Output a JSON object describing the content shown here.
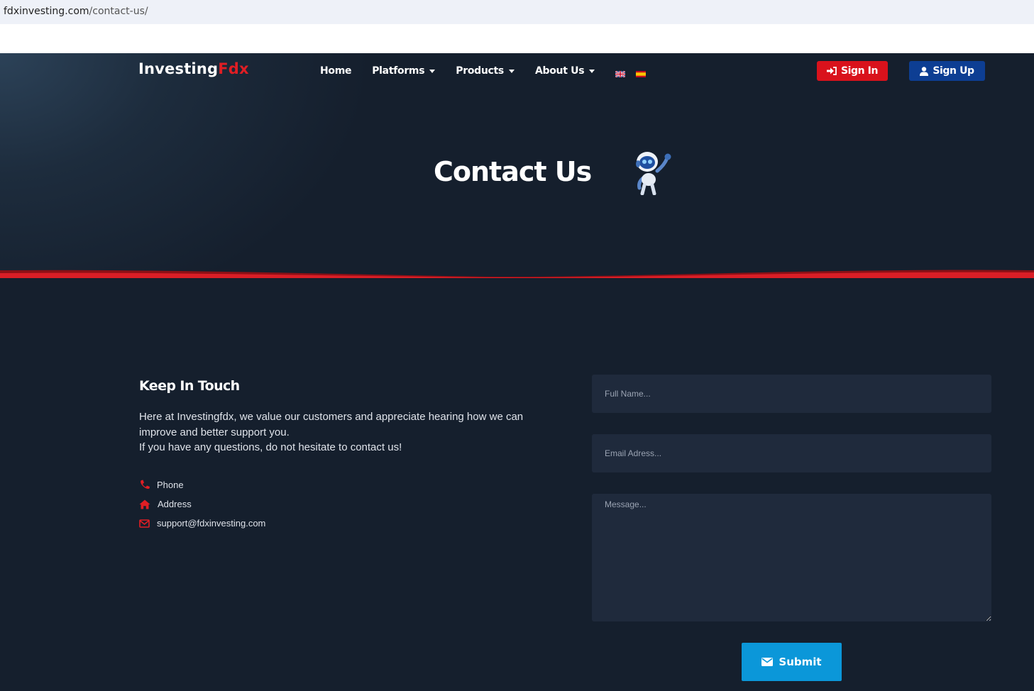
{
  "browser": {
    "url_domain": "fdxinvesting.com",
    "url_path": "/contact-us/"
  },
  "header": {
    "logo_main": "Investing",
    "logo_accent": "Fdx",
    "nav": [
      {
        "label": "Home",
        "has_dropdown": false
      },
      {
        "label": "Platforms",
        "has_dropdown": true
      },
      {
        "label": "Products",
        "has_dropdown": true
      },
      {
        "label": "About Us",
        "has_dropdown": true
      }
    ],
    "languages": [
      "english-flag-icon",
      "spanish-flag-icon"
    ],
    "signin_label": "Sign In",
    "signup_label": "Sign Up"
  },
  "hero": {
    "title": "Contact Us"
  },
  "contact": {
    "title": "Keep In Touch",
    "paragraph_1": "Here at Investingfdx, we value our customers and appreciate hearing how we can improve and better support you.",
    "paragraph_2": "If you have any questions, do not hesitate to contact us!",
    "items": [
      {
        "icon": "phone-icon",
        "label": "Phone"
      },
      {
        "icon": "home-icon",
        "label": "Address"
      },
      {
        "icon": "envelope-icon",
        "label": "support@fdxinvesting.com"
      }
    ]
  },
  "form": {
    "name_placeholder": "Full Name...",
    "email_placeholder": "Email Adress...",
    "message_placeholder": "Message...",
    "submit_label": "Submit"
  },
  "colors": {
    "background": "#151f2d",
    "accent_red": "#d9121c",
    "signup_blue": "#0d3e93",
    "submit_blue": "#0b97d9",
    "field_bg": "#1f2a3c"
  }
}
